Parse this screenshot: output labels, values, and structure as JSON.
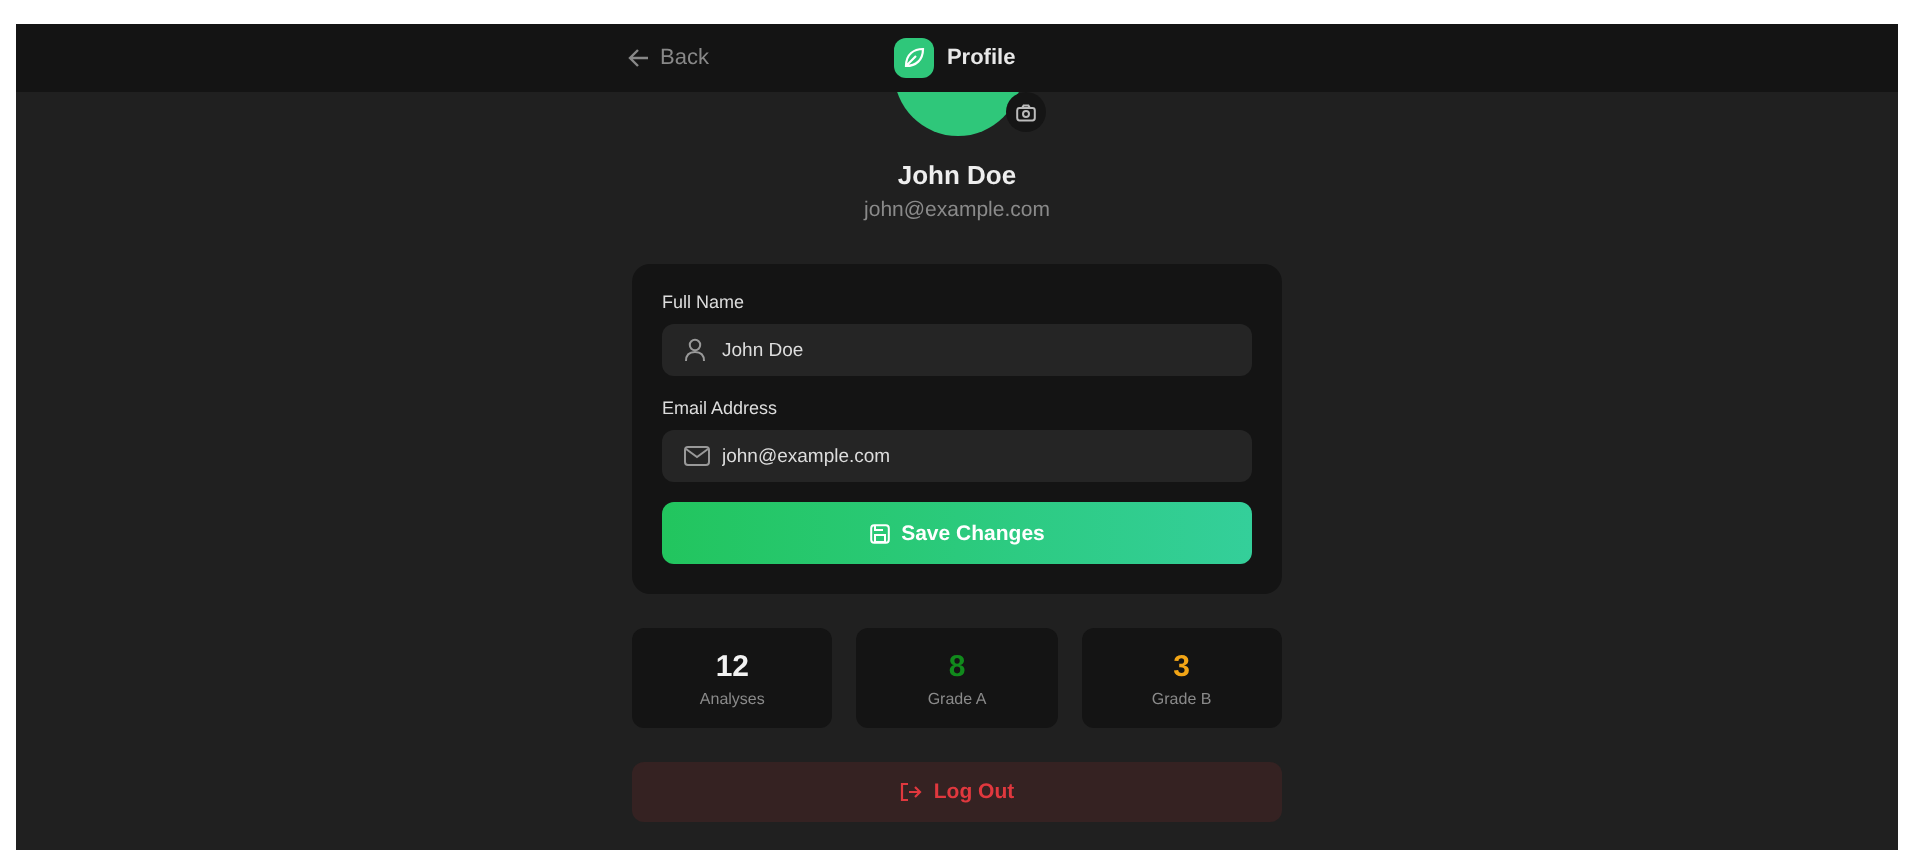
{
  "header": {
    "back": "Back",
    "title": "Profile"
  },
  "profile": {
    "name": "John Doe",
    "email": "john@example.com"
  },
  "form": {
    "fields": [
      {
        "label": "Full Name",
        "value": "John Doe",
        "kind": "person"
      },
      {
        "label": "Email Address",
        "value": "john@example.com",
        "kind": "mail"
      }
    ],
    "save": "Save Changes"
  },
  "stats": [
    {
      "value": "12",
      "label": "Analyses",
      "color": "#f2f2f2"
    },
    {
      "value": "8",
      "label": "Grade A",
      "color": "#118a1c"
    },
    {
      "value": "3",
      "label": "Grade B",
      "color": "#f2a516"
    }
  ],
  "logout": "Log Out"
}
